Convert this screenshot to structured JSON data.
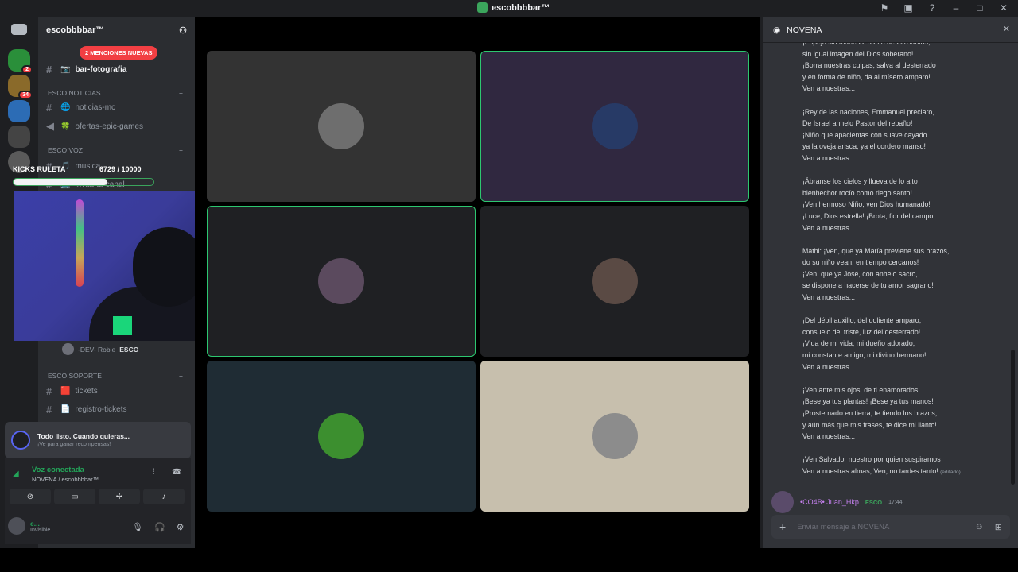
{
  "window": {
    "title": "escobbbbar™"
  },
  "server": {
    "name": "escobbbbar™",
    "mentions_badge": "2 MENCIONES NUEVAS"
  },
  "guild_badges": [
    "2",
    "34"
  ],
  "channels": [
    {
      "label": "bar-fotografia",
      "icon": "📷",
      "active": true
    },
    {
      "label": "noticias-mc",
      "icon": "🌐"
    },
    {
      "label": "ofertas-epic-games",
      "icon": "🍀"
    },
    {
      "label": "musica",
      "icon": "🎵"
    },
    {
      "label": "invita-tu-canal",
      "icon": "📺"
    },
    {
      "label": "tickets",
      "icon": "🟥"
    },
    {
      "label": "registro-tickets",
      "icon": "📄"
    }
  ],
  "categories": [
    "ESCO NOTICIAS",
    "ESCO VOZ",
    "ESCO SOPORTE"
  ],
  "kicks": {
    "label": "KICKS RULETA",
    "count": "6729  / 10000",
    "progress": 0.67
  },
  "voice_member": {
    "name": "-DEV- Roble",
    "tag": "ESCO"
  },
  "todo": {
    "title": "Todo listo. Cuando quieras...",
    "subtitle": "¡Ve para ganar recompensas!"
  },
  "voice": {
    "status": "Voz conectada",
    "location": "NOVENA / escobbbbar™"
  },
  "user": {
    "name": "e...",
    "status": "Invisible"
  },
  "thread": {
    "title": "NOVENA",
    "text": "¡Espejo sin mancha, santo de los santos,\nsin igual imagen del Dios soberano!\n¡Borra nuestras culpas, salva al desterrado\ny en forma de niño, da al mísero amparo!\nVen a nuestras...\n\n¡Rey de las naciones, Emmanuel preclaro,\nDe Israel anhelo Pastor del rebaño!\n¡Niño que apacientas con suave cayado\nya la oveja arisca, ya el cordero manso!\nVen a nuestras...\n\n¡Ábranse los cielos y llueva de lo alto\nbienhechor rocío como riego santo!\n¡Ven hermoso Niño, ven Dios humanado!\n¡Luce, Dios estrella! ¡Brota, flor del campo!\nVen a nuestras...\n\nMathi: ¡Ven, que ya María previene sus brazos,\ndo su niño vean, en tiempo cercanos!\n¡Ven, que ya José, con anhelo sacro,\nse dispone a hacerse de tu amor sagrario!\nVen a nuestras...\n\n¡Del débil auxilio, del doliente amparo,\nconsuelo del triste, luz del desterrado!\n¡Vida de mi vida, mi dueño adorado,\nmi constante amigo, mi divino hermano!\nVen a nuestras...\n\n¡Ven ante mis ojos, de ti enamorados!\n¡Bese ya tus plantas! ¡Bese ya tus manos!\n¡Prosternado en tierra, te tiendo los brazos,\ny aún más que mis frases, te dice mi llanto!\nVen a nuestras...\n\n¡Ven Salvador nuestro por quien suspiramos\nVen a nuestras almas, Ven, no tardes tanto!",
    "edited": "(editado)",
    "next_author": "•CO4B• Juan_Hkp",
    "next_tag": "ESCO",
    "next_time": "17:44",
    "composer_placeholder": "Enviar mensaje a NOVENA"
  },
  "tiles": [
    {
      "bg": "#333333",
      "avatar": "#6e6e6e",
      "speaking": false
    },
    {
      "bg": "#302840",
      "avatar": "#273a66",
      "speaking": true
    },
    {
      "bg": "#1f2023",
      "avatar": "#5b4a5e",
      "speaking": true
    },
    {
      "bg": "#1f2023",
      "avatar": "#5a4a44",
      "speaking": false
    },
    {
      "bg": "#1f2c34",
      "avatar": "#3c8f2f",
      "speaking": false
    },
    {
      "bg": "#c7bfad",
      "avatar": "#8c8c8c",
      "speaking": false
    }
  ]
}
